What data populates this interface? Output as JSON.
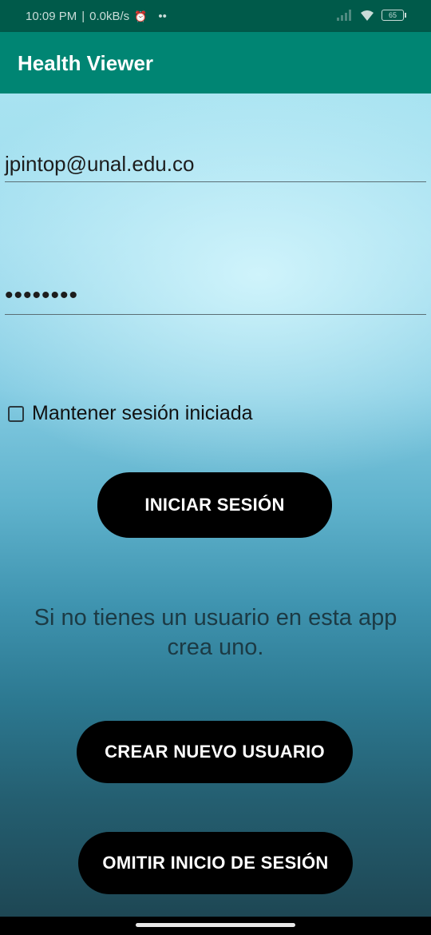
{
  "status_bar": {
    "time": "10:09 PM",
    "separator": "|",
    "network_speed": "0.0kB/s",
    "alarm_icon": "⏰",
    "dots": "••",
    "battery_level": "65"
  },
  "app_bar": {
    "title": "Health Viewer"
  },
  "login_form": {
    "email_value": "jpintop@unal.edu.co",
    "password_value": "••••••••",
    "keep_session_label": "Mantener sesión iniciada",
    "keep_session_checked": false,
    "login_button": "INICIAR SESIÓN"
  },
  "info": {
    "line1": "Si no tienes un usuario en esta app",
    "line2": "crea uno."
  },
  "actions": {
    "create_user_button": "CREAR NUEVO USUARIO",
    "skip_login_button": "OMITIR INICIO DE SESIÓN"
  },
  "icons": {
    "alarm": "alarm-icon",
    "wifi": "wifi-icon",
    "battery": "battery-icon",
    "signal": "signal-icon"
  }
}
